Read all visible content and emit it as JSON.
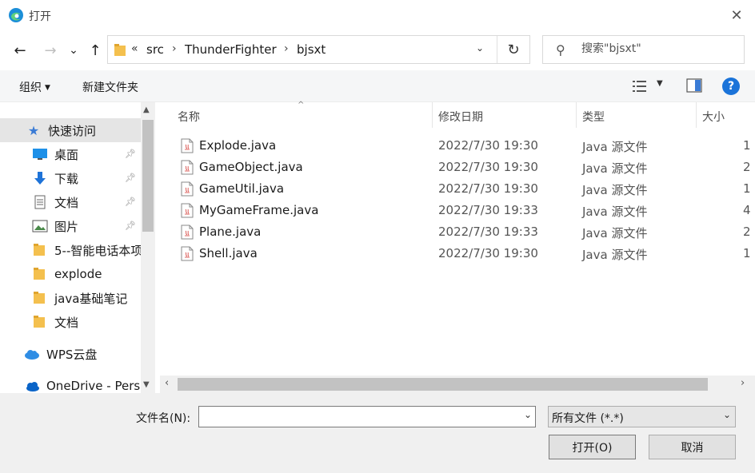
{
  "window": {
    "title": "打开",
    "close_label": "✕"
  },
  "navigation": {
    "back": "←",
    "forward": "→",
    "recent": "⌄",
    "up": "↑",
    "breadcrumb_prefix": "«",
    "breadcrumbs": [
      "src",
      "ThunderFighter",
      "bjsxt"
    ],
    "separator": "›",
    "dropdown": "⌄",
    "refresh": "↻"
  },
  "search": {
    "placeholder": "搜索\"bjsxt\"",
    "icon": "search-icon"
  },
  "toolbar": {
    "organize": "组织",
    "new_folder": "新建文件夹",
    "help": "?"
  },
  "sidebar": {
    "items": [
      {
        "label": "快速访问",
        "icon": "star-icon",
        "selected": true
      },
      {
        "label": "桌面",
        "icon": "desktop-icon",
        "pinned": true
      },
      {
        "label": "下载",
        "icon": "download-icon",
        "pinned": true
      },
      {
        "label": "文档",
        "icon": "document-icon",
        "pinned": true
      },
      {
        "label": "图片",
        "icon": "picture-icon",
        "pinned": true
      },
      {
        "label": "5--智能电话本项",
        "icon": "folder-icon"
      },
      {
        "label": "explode",
        "icon": "folder-icon"
      },
      {
        "label": "java基础笔记",
        "icon": "folder-icon"
      },
      {
        "label": "文档",
        "icon": "folder-icon"
      },
      {
        "label": "WPS云盘",
        "icon": "cloud-icon"
      },
      {
        "label": "OneDrive - Perso",
        "icon": "onedrive-icon"
      }
    ]
  },
  "columns": {
    "name": "名称",
    "modified": "修改日期",
    "type": "类型",
    "size": "大小"
  },
  "files": [
    {
      "name": "Explode.java",
      "modified": "2022/7/30 19:30",
      "type": "Java 源文件",
      "size": "1"
    },
    {
      "name": "GameObject.java",
      "modified": "2022/7/30 19:30",
      "type": "Java 源文件",
      "size": "2"
    },
    {
      "name": "GameUtil.java",
      "modified": "2022/7/30 19:30",
      "type": "Java 源文件",
      "size": "1"
    },
    {
      "name": "MyGameFrame.java",
      "modified": "2022/7/30 19:33",
      "type": "Java 源文件",
      "size": "4"
    },
    {
      "name": "Plane.java",
      "modified": "2022/7/30 19:33",
      "type": "Java 源文件",
      "size": "2"
    },
    {
      "name": "Shell.java",
      "modified": "2022/7/30 19:30",
      "type": "Java 源文件",
      "size": "1"
    }
  ],
  "footer": {
    "filename_label": "文件名(N):",
    "filename_value": "",
    "filter_value": "所有文件 (*.*)",
    "open_button": "打开(O)",
    "cancel_button": "取消"
  },
  "colors": {
    "accent": "#1a73d9",
    "folder": "#f4c04e",
    "selected_bg": "#e5e5e5"
  }
}
